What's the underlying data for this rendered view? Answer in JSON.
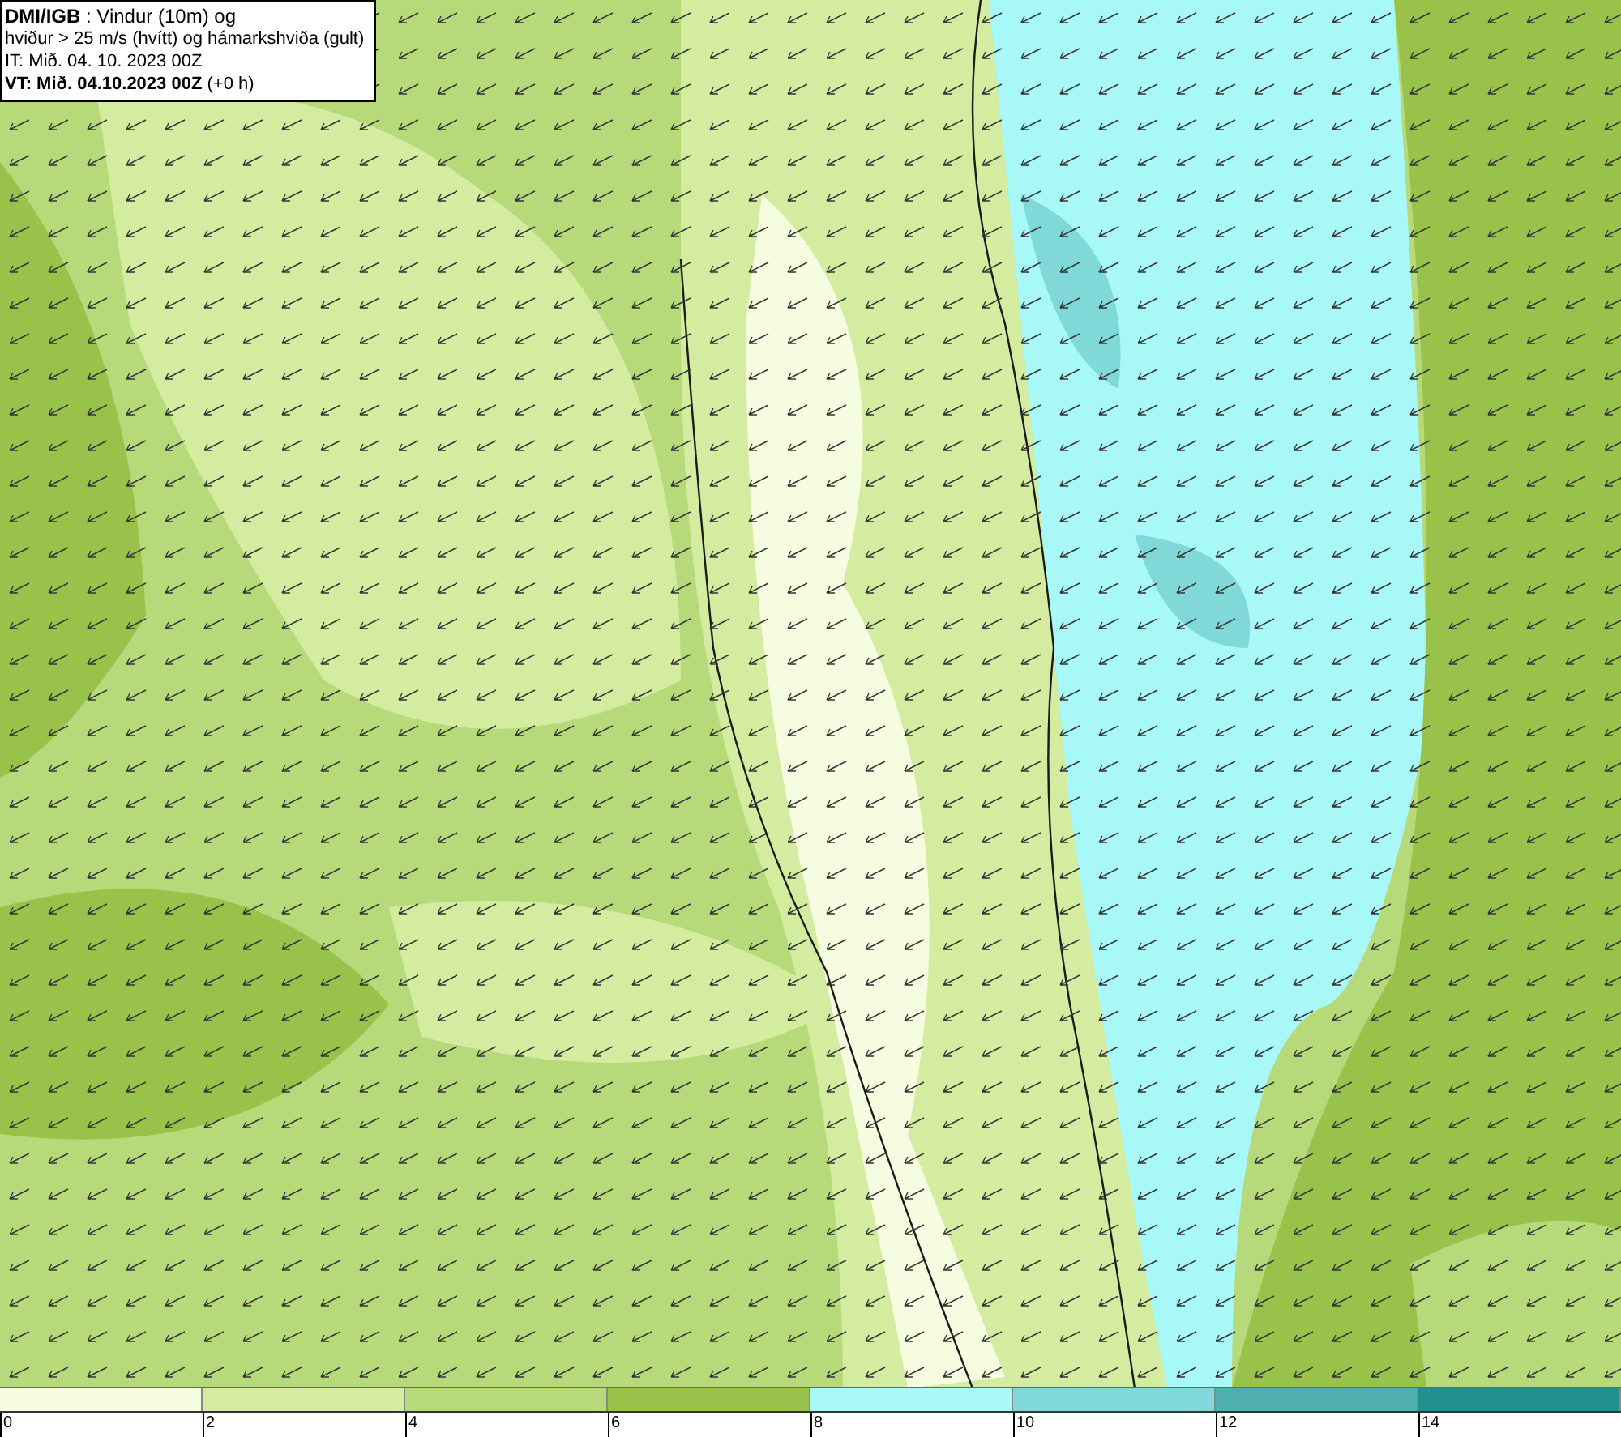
{
  "title_box": {
    "lines": [
      "**DMI/IGB** : Vindur (10m) og",
      "hviður > 25 m/s (hvítt) og hámarkshviða (gult)",
      "IT: Mið. 04. 10. 2023 00Z",
      "**VT: Mið. 04.10.2023 00Z** (+0 h)"
    ]
  },
  "legend": {
    "bins": [
      {
        "label": "0",
        "color": "#f5fce0"
      },
      {
        "label": "2",
        "color": "#d4eca0"
      },
      {
        "label": "4",
        "color": "#b6d97a"
      },
      {
        "label": "6",
        "color": "#98c24a"
      },
      {
        "label": "8",
        "color": "#a8f8f8"
      },
      {
        "label": "10",
        "color": "#80d8d8"
      },
      {
        "label": "12",
        "color": "#50b0b0"
      },
      {
        "label": "14",
        "color": "#209090"
      }
    ]
  }
}
